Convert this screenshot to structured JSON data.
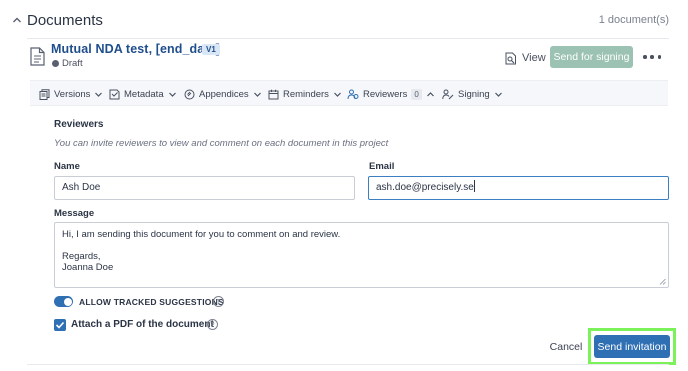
{
  "section": {
    "title": "Documents",
    "count_label": "1 document(s)"
  },
  "document": {
    "title": "Mutual NDA test, [end_date]",
    "version": "V1",
    "status": "Draft",
    "view_label": "View",
    "send_for_signing_label": "Send for signing"
  },
  "toolbar": {
    "items": [
      {
        "label": "Versions",
        "icon": "versions-icon"
      },
      {
        "label": "Metadata",
        "icon": "metadata-icon"
      },
      {
        "label": "Appendices",
        "icon": "paperclip-icon"
      },
      {
        "label": "Reminders",
        "icon": "calendar-icon"
      },
      {
        "label": "Reviewers",
        "icon": "reviewers-icon",
        "count": "0"
      },
      {
        "label": "Signing",
        "icon": "signing-icon"
      }
    ]
  },
  "reviewers_panel": {
    "heading": "Reviewers",
    "description": "You can invite reviewers to view and comment on each document in this project",
    "name_label": "Name",
    "name_value": "Ash Doe",
    "email_label": "Email",
    "email_value": "ash.doe@precisely.se",
    "message_label": "Message",
    "message_lines": [
      "Hi, I am sending this document for you to comment on and review.",
      "",
      "Regards,",
      "Joanna Doe"
    ],
    "tracked_suggestions_label": "ALLOW TRACKED SUGGESTIONS",
    "tracked_suggestions_enabled": true,
    "attach_pdf_label": "Attach a PDF of the document",
    "attach_pdf_checked": true,
    "help_glyph": "?",
    "cancel_label": "Cancel",
    "send_invitation_label": "Send invitation"
  },
  "colors": {
    "primary": "#2f6fb3",
    "title_blue": "#1f4e8c",
    "signing_button": "#9cc2b3",
    "highlight": "#7cf25a"
  }
}
